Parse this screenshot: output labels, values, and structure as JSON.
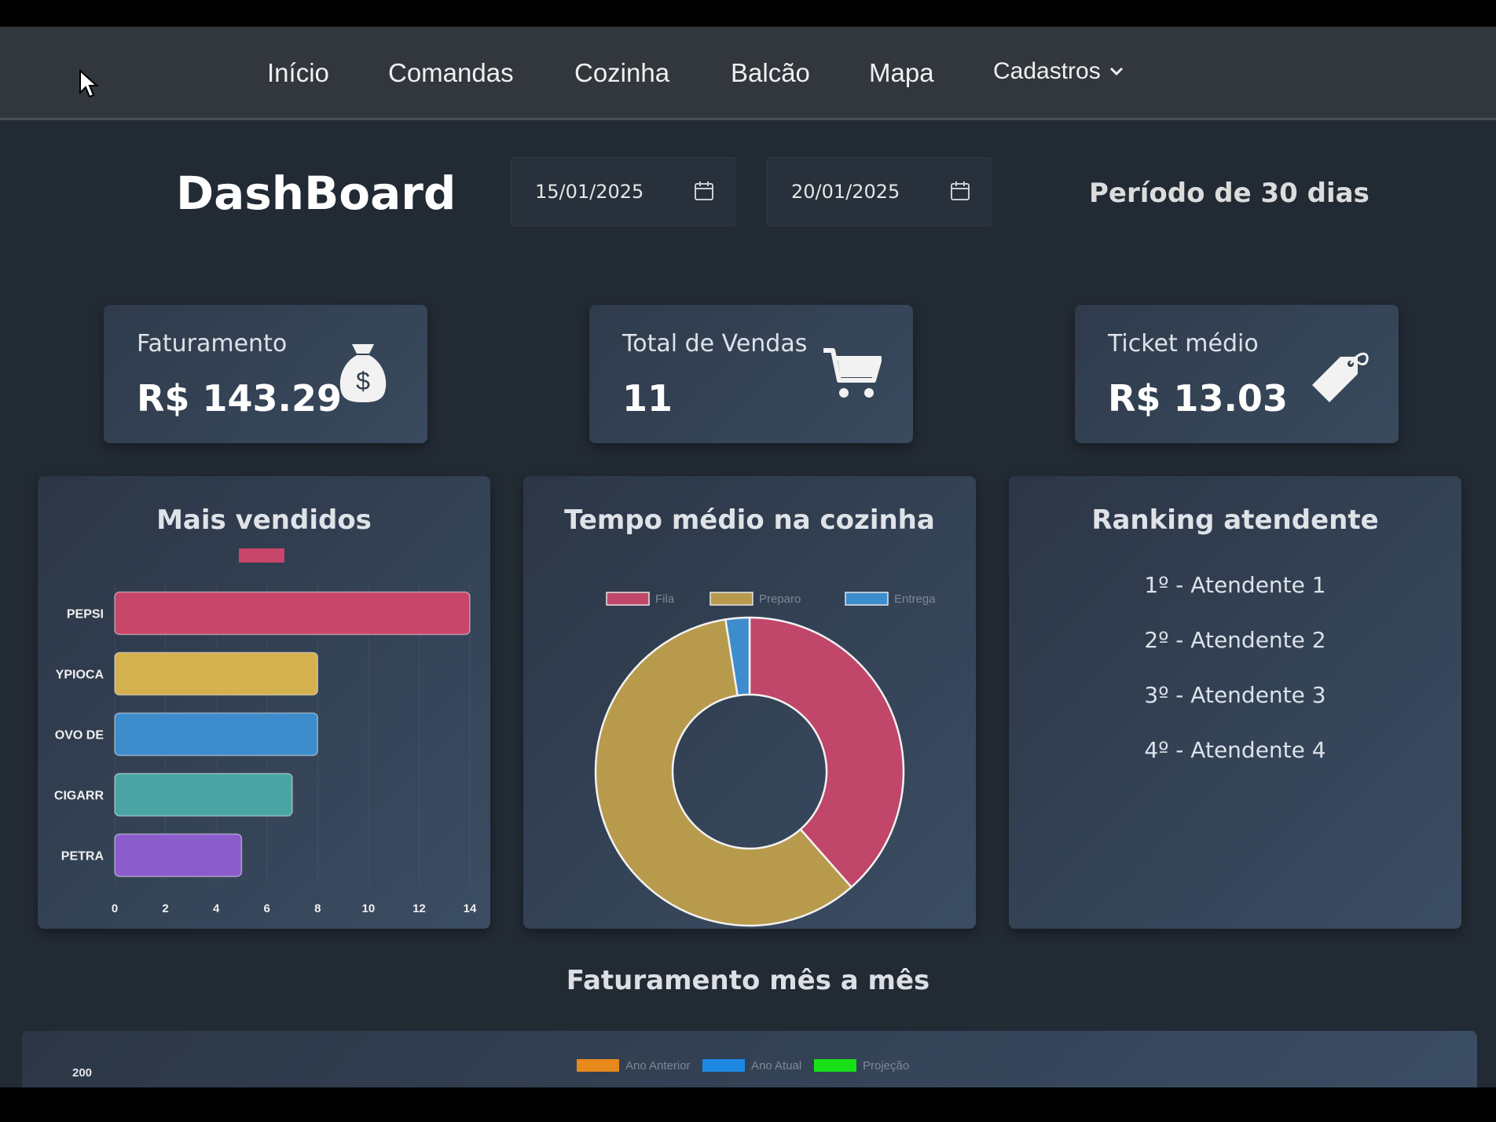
{
  "nav": {
    "items": [
      "Início",
      "Comandas",
      "Cozinha",
      "Balcão",
      "Mapa"
    ],
    "dropdown_label": "Cadastros"
  },
  "header": {
    "title": "DashBoard",
    "date_start": "15/01/2025",
    "date_end": "20/01/2025",
    "period_text": "Período de 30 dias"
  },
  "cards": {
    "revenue": {
      "label": "Faturamento",
      "value": "R$ 143.29",
      "icon": "money-bag-icon"
    },
    "sales": {
      "label": "Total de Vendas",
      "value": "11",
      "icon": "cart-icon"
    },
    "ticket": {
      "label": "Ticket médio",
      "value": "R$ 13.03",
      "icon": "tag-icon"
    }
  },
  "panels": {
    "best_sellers_title": "Mais vendidos",
    "kitchen_title": "Tempo médio na cozinha",
    "ranking_title": "Ranking atendente"
  },
  "ranking": [
    "1º - Atendente 1",
    "2º - Atendente 2",
    "3º - Atendente 3",
    "4º - Atendente 4"
  ],
  "monthly": {
    "title": "Faturamento mês a mês",
    "legend": [
      {
        "name": "Ano Anterior",
        "color": "#e8891c"
      },
      {
        "name": "Ano Atual",
        "color": "#1e88e5"
      },
      {
        "name": "Projeção",
        "color": "#18e018"
      }
    ],
    "y_tick_top": "200"
  },
  "chart_data": [
    {
      "type": "bar",
      "orientation": "horizontal",
      "title": "Mais vendidos",
      "categories": [
        "PEPSI",
        "YPIOCA",
        "OVO DE",
        "CIGARR",
        "PETRA"
      ],
      "values": [
        14,
        8,
        8,
        7,
        5
      ],
      "colors": [
        "#c8466a",
        "#d4b04e",
        "#3d8ccc",
        "#4aa4a4",
        "#8a5ccc"
      ],
      "xlim": [
        0,
        14
      ],
      "xticks": [
        0,
        2,
        4,
        6,
        8,
        10,
        12,
        14
      ],
      "legend_color": "#c8466a"
    },
    {
      "type": "pie",
      "title": "Tempo médio na cozinha",
      "labels": [
        "Fila",
        "Preparo",
        "Entrega"
      ],
      "values": [
        38.5,
        59,
        2.5
      ],
      "colors": [
        "#c0466a",
        "#b89a4c",
        "#3d8ccc"
      ],
      "legend_position": "top"
    }
  ]
}
